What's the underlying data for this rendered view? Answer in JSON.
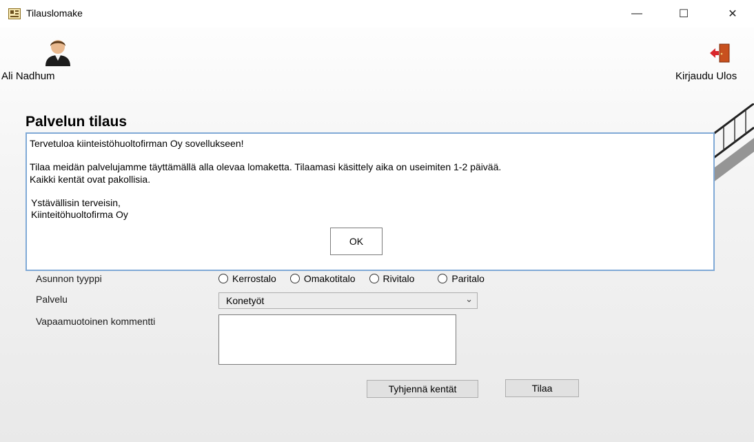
{
  "window": {
    "title": "Tilauslomake",
    "minimize_glyph": "—",
    "maximize_glyph": "☐",
    "close_glyph": "✕"
  },
  "user": {
    "name": "Ali Nadhum",
    "icon": "user-avatar-icon"
  },
  "logout": {
    "label": "Kirjaudu Ulos",
    "icon": "logout-door-icon"
  },
  "page": {
    "heading": "Palvelun tilaus"
  },
  "dialog": {
    "line1": "Tervetuloa kiinteistöhuoltofirman Oy sovellukseen!",
    "line2": "Tilaa meidän palvelujamme täyttämällä alla olevaa lomaketta. Tilaamasi käsittely aika on useimiten 1-2 päivää.",
    "line3": "Kaikki kentät ovat pakollisia.",
    "line4": "Ystävällisin terveisin,",
    "line5": "Kiinteitöhuoltofirma Oy",
    "ok_label": "OK"
  },
  "form": {
    "housing_type_label": "Asunnon tyyppi",
    "housing_options": [
      "Kerrostalo",
      "Omakotitalo",
      "Rivitalo",
      "Paritalo"
    ],
    "service_label": "Palvelu",
    "service_value": "Konetyöt",
    "comment_label": "Vapaamuotoinen kommentti",
    "comment_value": "",
    "clear_button": "Tyhjennä kentät",
    "order_button": "Tilaa"
  },
  "colors": {
    "dialog_border": "#7fa9d6",
    "logout_arrow": "#d9262b",
    "door": "#c8501e"
  }
}
